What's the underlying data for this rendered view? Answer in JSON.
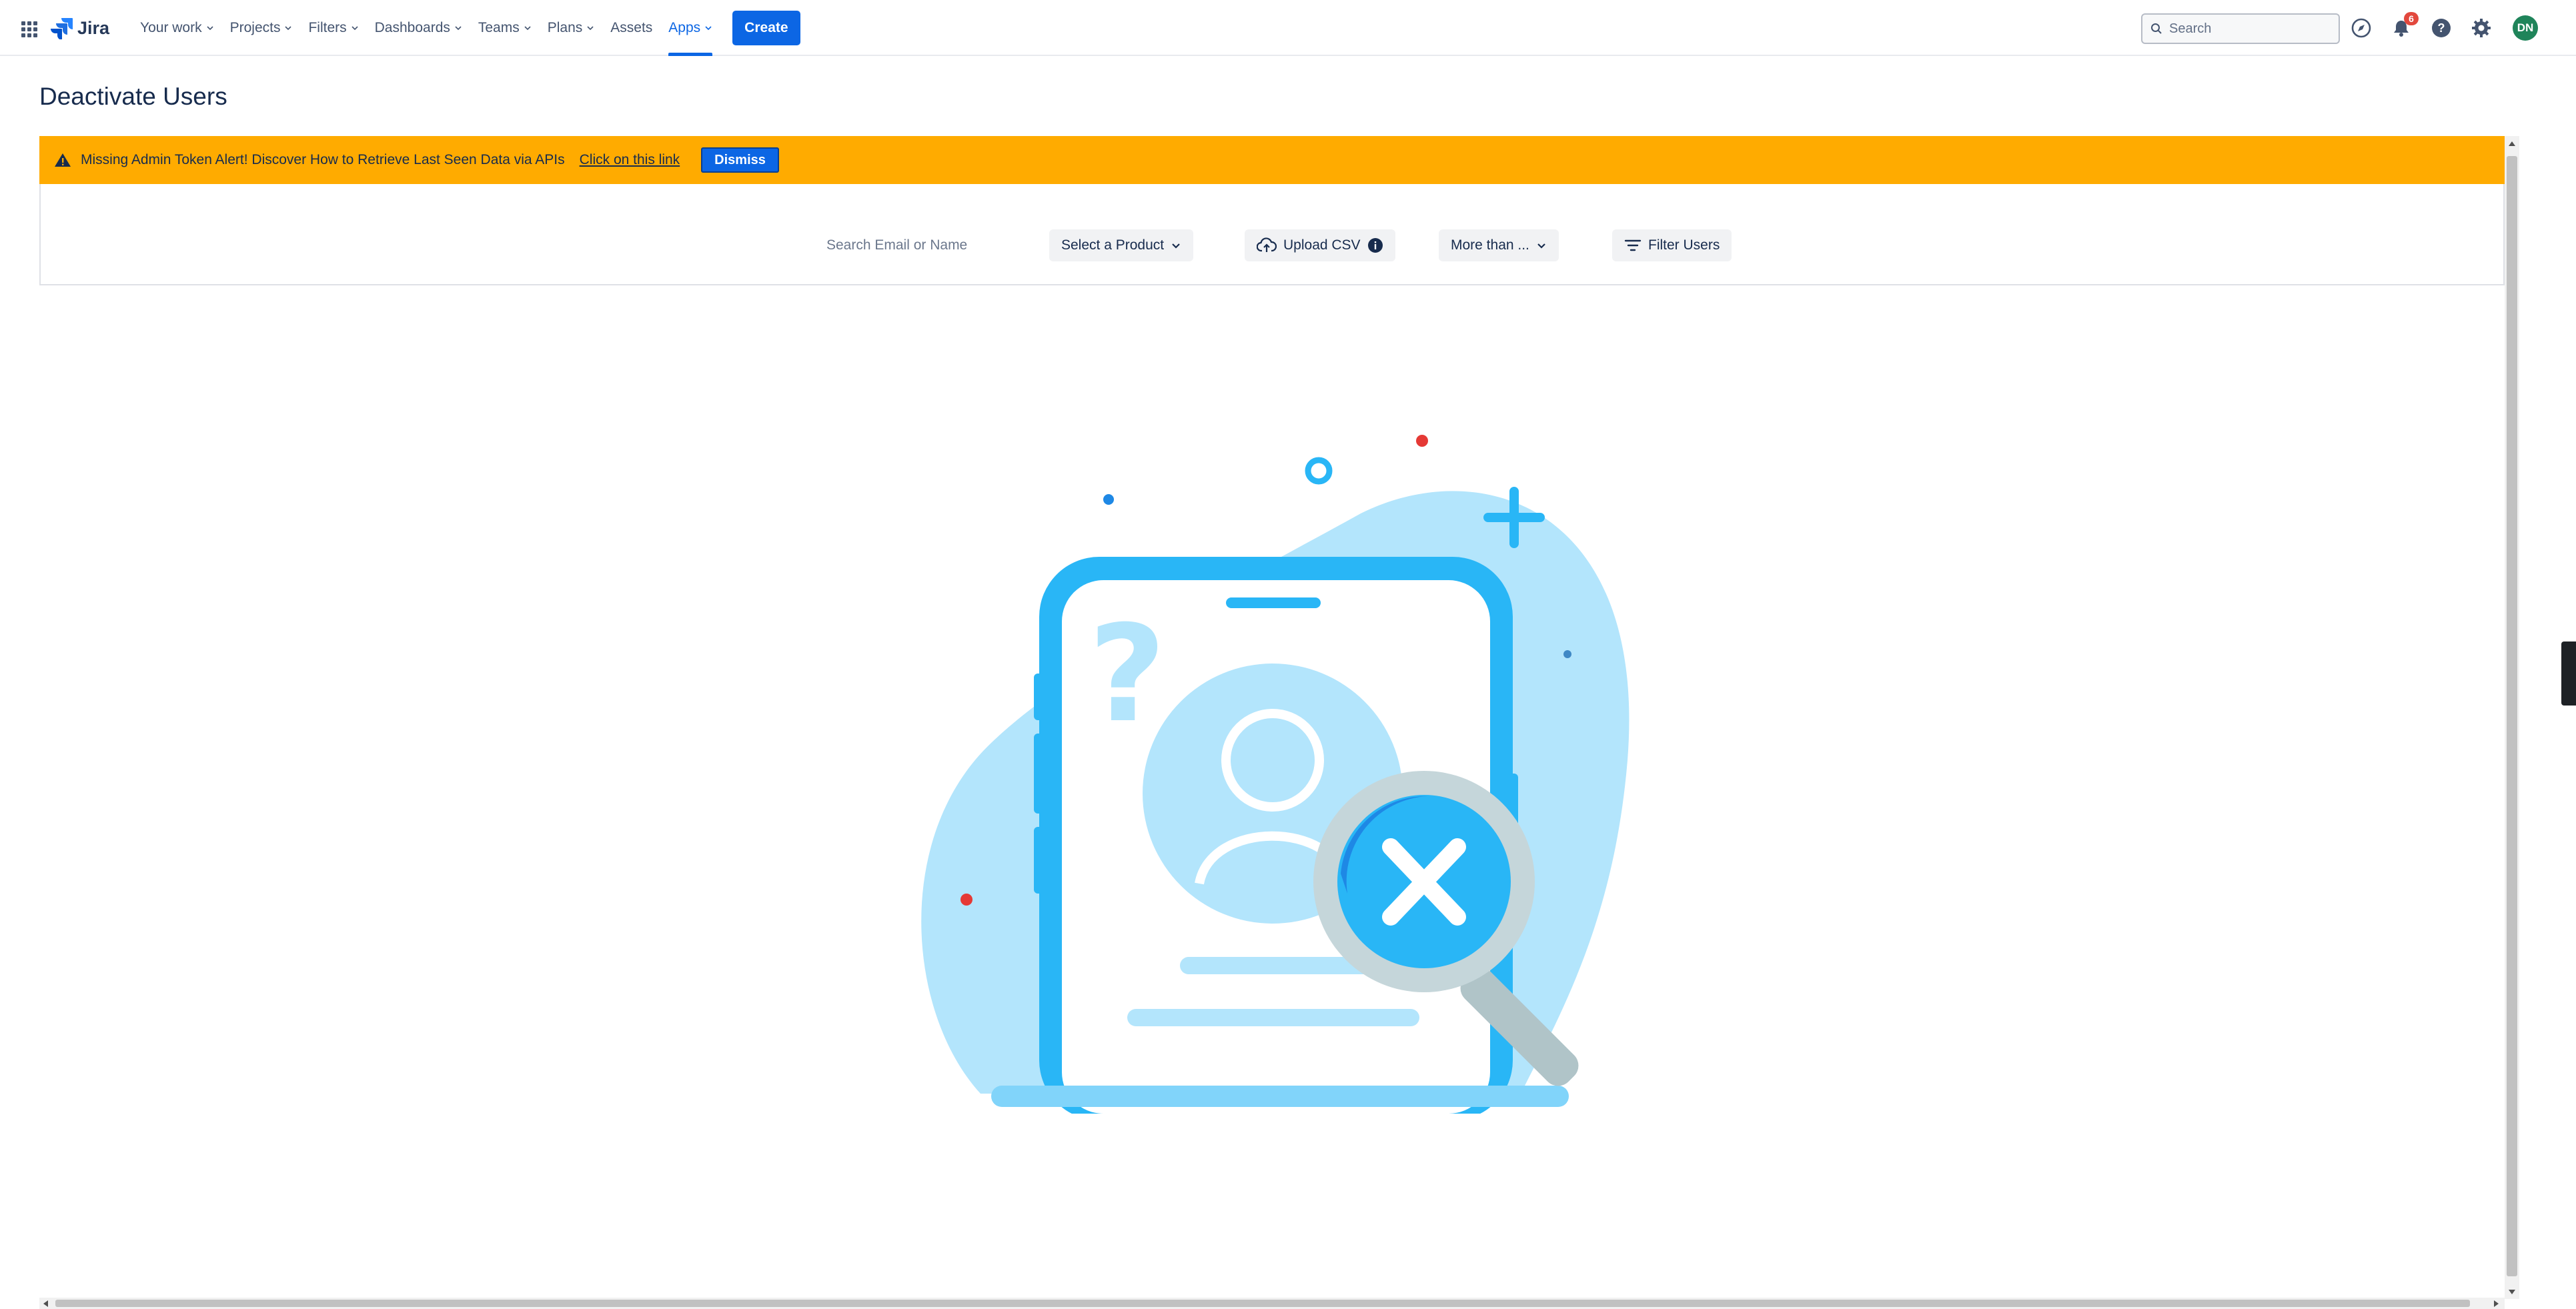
{
  "nav": {
    "logo": "Jira",
    "items": [
      {
        "label": "Your work",
        "dropdown": true
      },
      {
        "label": "Projects",
        "dropdown": true
      },
      {
        "label": "Filters",
        "dropdown": true
      },
      {
        "label": "Dashboards",
        "dropdown": true
      },
      {
        "label": "Teams",
        "dropdown": true
      },
      {
        "label": "Plans",
        "dropdown": true
      },
      {
        "label": "Assets",
        "dropdown": false
      },
      {
        "label": "Apps",
        "dropdown": true,
        "active": true
      }
    ],
    "create_label": "Create",
    "search_placeholder": "Search",
    "notification_count": "6",
    "avatar_initials": "DN"
  },
  "page": {
    "title": "Deactivate Users"
  },
  "alert": {
    "text": "Missing Admin Token Alert! Discover How to Retrieve Last Seen Data via APIs",
    "link": "Click on this link",
    "dismiss": "Dismiss"
  },
  "filters": {
    "search_placeholder": "Search Email or Name",
    "product_select": "Select a Product",
    "upload_label": "Upload CSV",
    "more_than": "More than ...",
    "filter_users": "Filter Users"
  },
  "colors": {
    "brand_blue": "#0c66e4",
    "alert_yellow": "#ffab00",
    "illustration_blue": "#29b6f6",
    "illustration_light": "#b3e5fc",
    "avatar_green": "#1f845a"
  },
  "icons": [
    "app-switcher-icon",
    "jira-logo-icon",
    "search-icon",
    "compass-icon",
    "bell-icon",
    "help-icon",
    "settings-icon",
    "warning-icon",
    "cloud-upload-icon",
    "info-icon",
    "chevron-down-icon",
    "filter-icon"
  ]
}
